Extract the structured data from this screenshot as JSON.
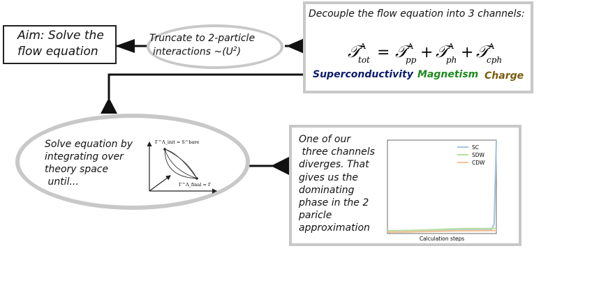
{
  "aim": {
    "line1": "Aim: Solve the",
    "line2": "flow equation"
  },
  "truncate": {
    "line1": "Truncate to 2-particle",
    "line2_prefix": "interactions ~(U",
    "line2_sup": "2",
    "line2_suffix": ")"
  },
  "decouple": {
    "title": "Decouple the flow equation into 3 channels:",
    "equation": {
      "lhs_sub": "tot",
      "rhs1_sub": "pp",
      "rhs2_sub": "ph",
      "rhs3_sub": "cph",
      "sup": "Λ",
      "symbol": "𝒯",
      "equals": "=",
      "plus": "+"
    },
    "channels": [
      "Superconductivity",
      "Magnetism",
      "Charge"
    ]
  },
  "solve": {
    "lines": [
      "Solve equation by",
      "integrating over",
      "theory space",
      " until..."
    ],
    "diagram": {
      "top_label": "Γ^Λ_init = S^bare",
      "bottom_label": "Γ^Λ_final = Γ"
    }
  },
  "result": {
    "lines": [
      "One of our",
      " three channels",
      "diverges. That",
      "gives us the",
      "dominating",
      "phase in the 2",
      "paricle",
      "approximation"
    ]
  },
  "chart_data": {
    "type": "line",
    "xlabel": "Calculation steps",
    "ylabel": "",
    "title": "",
    "x": [
      0,
      10,
      20,
      30,
      40,
      50,
      60,
      70,
      80,
      90,
      95,
      98,
      100
    ],
    "ylim": [
      0,
      100
    ],
    "legend_position": "top-right",
    "series": [
      {
        "name": "SC",
        "color": "#a7c3e0",
        "values": [
          2,
          2,
          2.2,
          2.5,
          2.8,
          3.2,
          3.5,
          3.6,
          3.6,
          3.7,
          4,
          10,
          100
        ]
      },
      {
        "name": "SDW",
        "color": "#b9dfa4",
        "values": [
          3,
          3,
          3.3,
          3.6,
          4,
          4.5,
          5,
          5.2,
          5.3,
          5.3,
          5.4,
          5.4,
          5.5
        ]
      },
      {
        "name": "CDW",
        "color": "#f2c49a",
        "values": [
          1.5,
          1.6,
          1.8,
          2,
          2.2,
          2.5,
          2.8,
          2.9,
          3,
          3,
          3.1,
          3.1,
          3.2
        ]
      }
    ]
  },
  "colors": {
    "superconductivity": "#0d1a6e",
    "magnetism": "#1e8a1e",
    "charge": "#7a5a10",
    "frame": "#c8c8c8"
  }
}
